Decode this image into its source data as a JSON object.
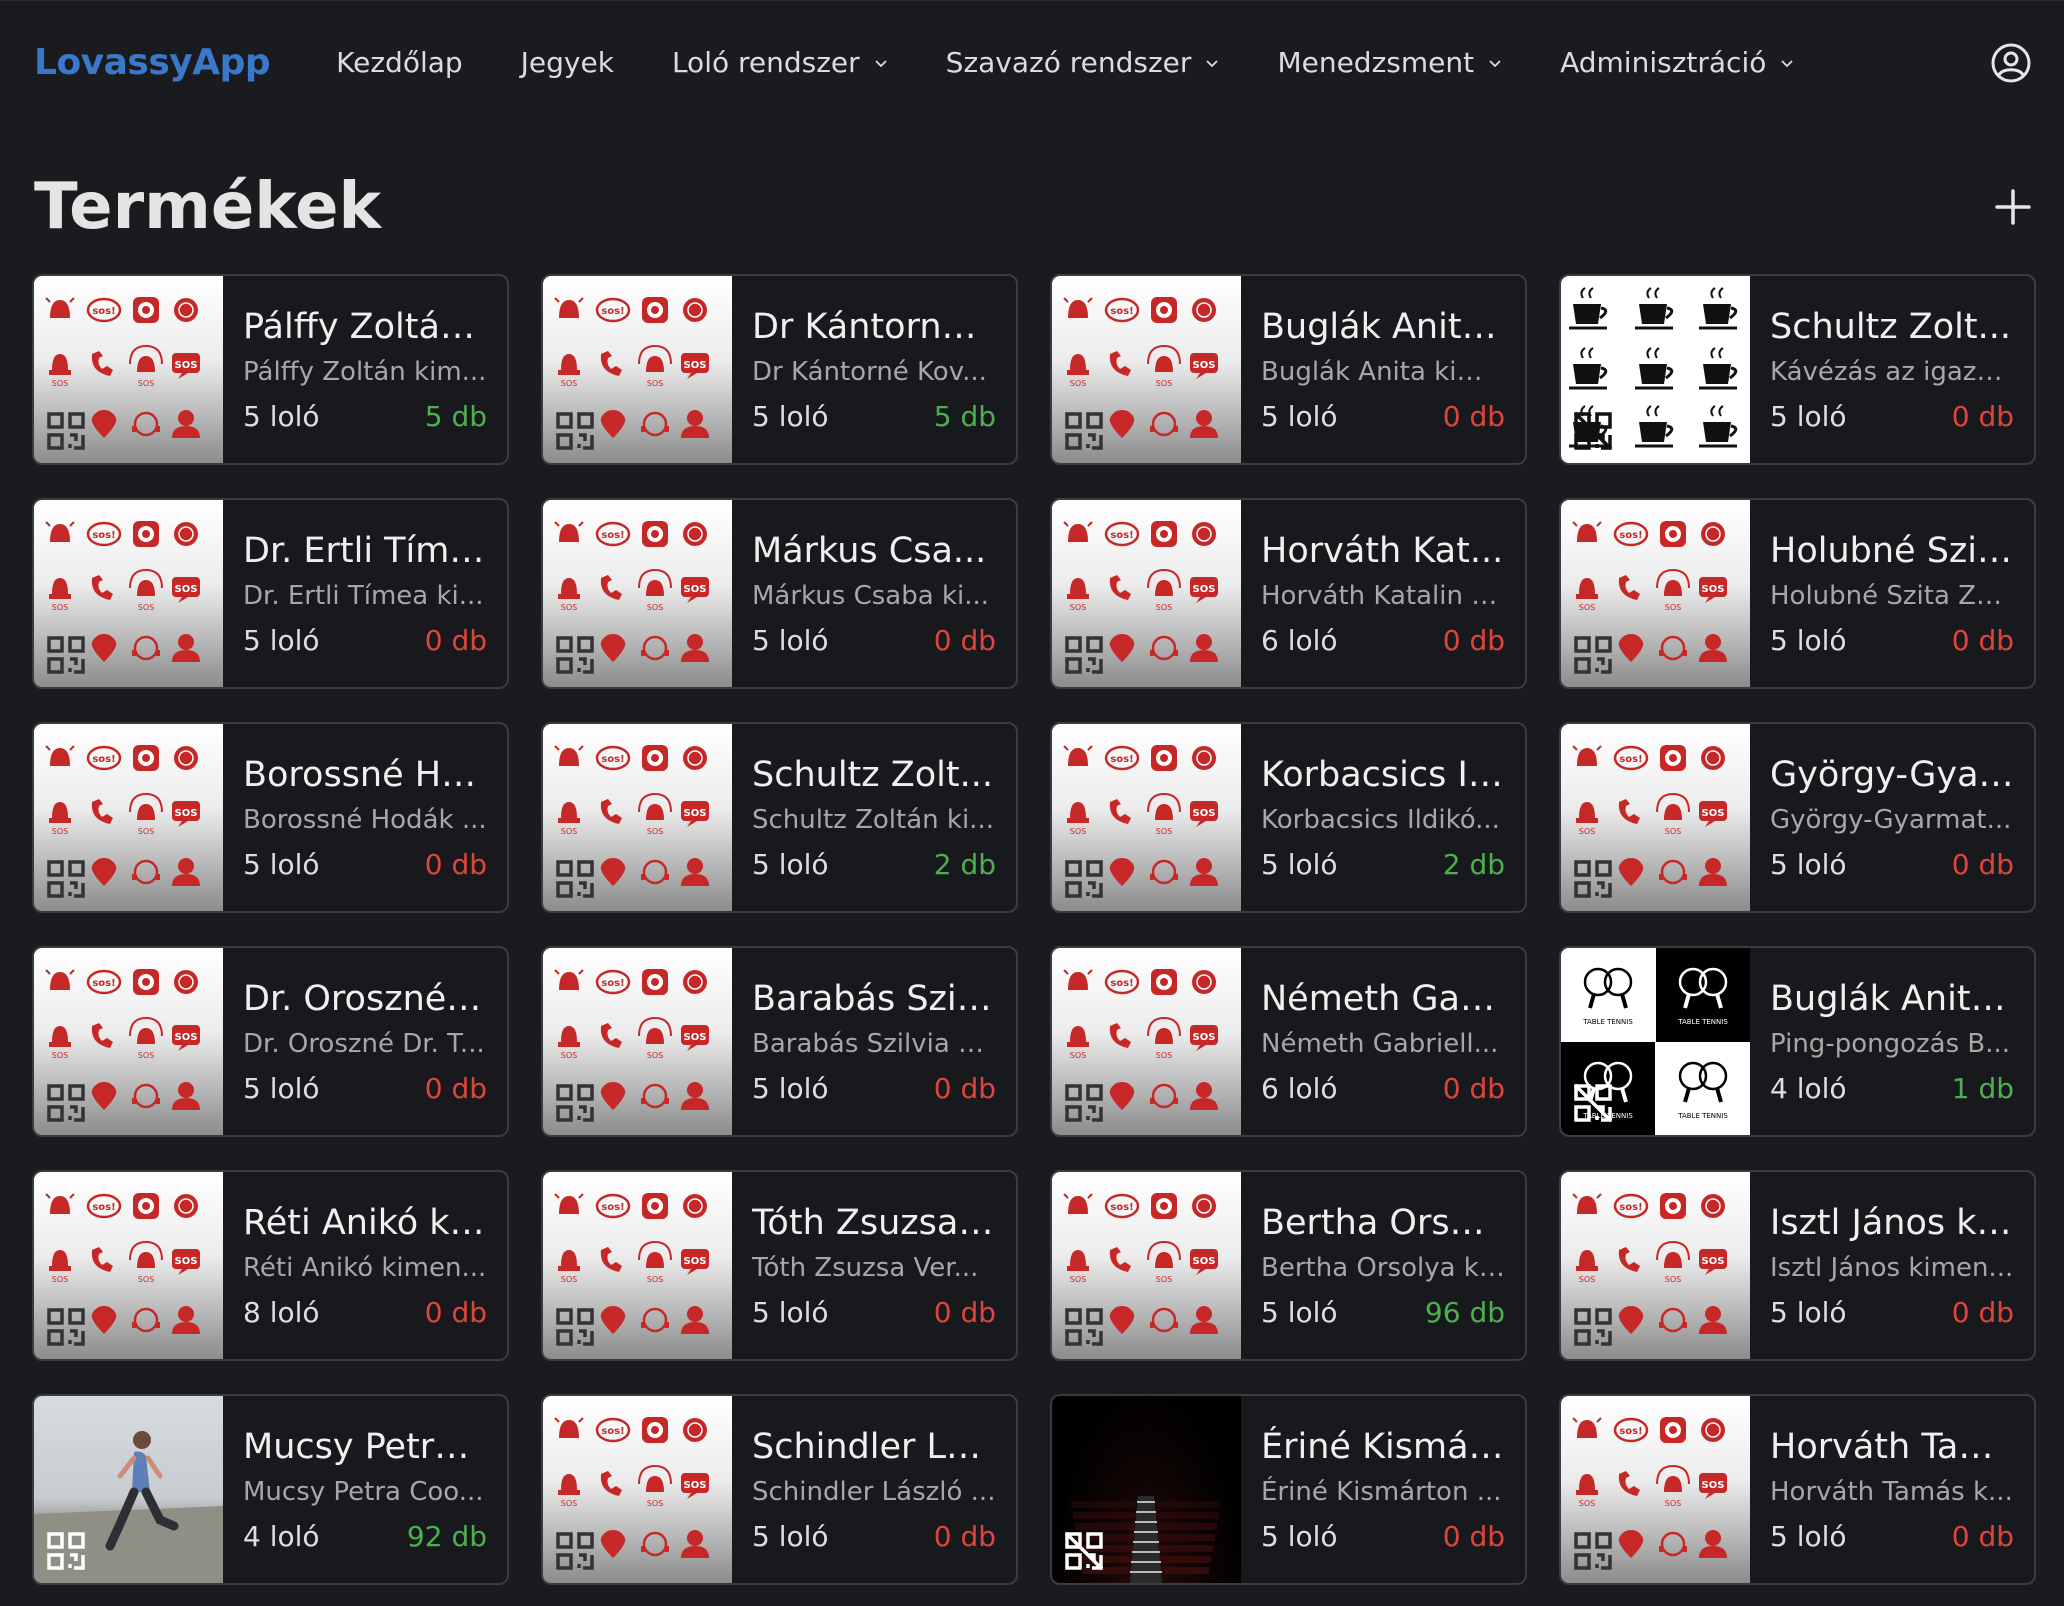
{
  "app": {
    "brand": "LovassyApp"
  },
  "nav": [
    {
      "label": "Kezdőlap",
      "dropdown": false
    },
    {
      "label": "Jegyek",
      "dropdown": false
    },
    {
      "label": "Loló rendszer",
      "dropdown": true
    },
    {
      "label": "Szavazó rendszer",
      "dropdown": true
    },
    {
      "label": "Menedzsment",
      "dropdown": true
    },
    {
      "label": "Adminisztráció",
      "dropdown": true
    }
  ],
  "page": {
    "title": "Termékek"
  },
  "colors": {
    "brand": "#3a78c9",
    "in_stock": "#4caf50",
    "out_of_stock": "#e0433c",
    "sos_red": "#c62828"
  },
  "products": [
    {
      "title": "Pálffy Zoltán...",
      "subtitle": "Pálffy Zoltán kim...",
      "price": "5 loló",
      "stock": "5 db",
      "in_stock": true,
      "image": "sos",
      "qr": true
    },
    {
      "title": "Dr Kántorné ...",
      "subtitle": "Dr Kántorné Kov...",
      "price": "5 loló",
      "stock": "5 db",
      "in_stock": true,
      "image": "sos",
      "qr": true
    },
    {
      "title": "Buglák Anita...",
      "subtitle": "Buglák Anita kim...",
      "price": "5 loló",
      "stock": "0 db",
      "in_stock": false,
      "image": "sos",
      "qr": true
    },
    {
      "title": "Schultz Zolt...",
      "subtitle": "Kávézás az igazg...",
      "price": "5 loló",
      "stock": "0 db",
      "in_stock": false,
      "image": "coffee",
      "qr": false
    },
    {
      "title": "Dr. Ertli Tíme...",
      "subtitle": "Dr. Ertli Tímea ki...",
      "price": "5 loló",
      "stock": "0 db",
      "in_stock": false,
      "image": "sos",
      "qr": true
    },
    {
      "title": "Márkus Csa...",
      "subtitle": "Márkus Csaba ki...",
      "price": "5 loló",
      "stock": "0 db",
      "in_stock": false,
      "image": "sos",
      "qr": true
    },
    {
      "title": "Horváth Kat...",
      "subtitle": "Horváth Katalin k...",
      "price": "6 loló",
      "stock": "0 db",
      "in_stock": false,
      "image": "sos",
      "qr": true
    },
    {
      "title": "Holubné Szit...",
      "subtitle": "Holubné Szita Zs...",
      "price": "5 loló",
      "stock": "0 db",
      "in_stock": false,
      "image": "sos",
      "qr": true
    },
    {
      "title": "Borossné Ho...",
      "subtitle": "Borossné Hodák ...",
      "price": "5 loló",
      "stock": "0 db",
      "in_stock": false,
      "image": "sos",
      "qr": true
    },
    {
      "title": "Schultz Zolt...",
      "subtitle": "Schultz Zoltán ki...",
      "price": "5 loló",
      "stock": "2 db",
      "in_stock": true,
      "image": "sos",
      "qr": true
    },
    {
      "title": "Korbacsics Il...",
      "subtitle": "Korbacsics Ildikó...",
      "price": "5 loló",
      "stock": "2 db",
      "in_stock": true,
      "image": "sos",
      "qr": true
    },
    {
      "title": "György-Gyar...",
      "subtitle": "György-Gyarmat...",
      "price": "5 loló",
      "stock": "0 db",
      "in_stock": false,
      "image": "sos",
      "qr": true
    },
    {
      "title": "Dr. Oroszné ...",
      "subtitle": "Dr. Oroszné Dr. T...",
      "price": "5 loló",
      "stock": "0 db",
      "in_stock": false,
      "image": "sos",
      "qr": true
    },
    {
      "title": "Barabás Szil...",
      "subtitle": "Barabás Szilvia k...",
      "price": "5 loló",
      "stock": "0 db",
      "in_stock": false,
      "image": "sos",
      "qr": true
    },
    {
      "title": "Németh Gab...",
      "subtitle": "Németh Gabriell...",
      "price": "6 loló",
      "stock": "0 db",
      "in_stock": false,
      "image": "sos",
      "qr": true
    },
    {
      "title": "Buglák Anita...",
      "subtitle": "Ping-pongozás B...",
      "price": "4 loló",
      "stock": "1 db",
      "in_stock": true,
      "image": "tennis",
      "qr": false
    },
    {
      "title": "Réti Anikó ki...",
      "subtitle": "Réti Anikó kimen...",
      "price": "8 loló",
      "stock": "0 db",
      "in_stock": false,
      "image": "sos",
      "qr": true
    },
    {
      "title": "Tóth Zsuzsa ...",
      "subtitle": "Tóth Zsuzsa Ver...",
      "price": "5 loló",
      "stock": "0 db",
      "in_stock": false,
      "image": "sos",
      "qr": true
    },
    {
      "title": "Bertha Orsol...",
      "subtitle": "Bertha Orsolya ki...",
      "price": "5 loló",
      "stock": "96 db",
      "in_stock": true,
      "image": "sos",
      "qr": true
    },
    {
      "title": "Isztl János ki...",
      "subtitle": "Isztl János kimen...",
      "price": "5 loló",
      "stock": "0 db",
      "in_stock": false,
      "image": "sos",
      "qr": true
    },
    {
      "title": "Mucsy Petra ...",
      "subtitle": "Mucsy Petra Coo...",
      "price": "4 loló",
      "stock": "92 db",
      "in_stock": true,
      "image": "runner",
      "qr": true
    },
    {
      "title": "Schindler Lá...",
      "subtitle": "Schindler László ...",
      "price": "5 loló",
      "stock": "0 db",
      "in_stock": false,
      "image": "sos",
      "qr": true
    },
    {
      "title": "Ériné Kismár...",
      "subtitle": "Ériné Kismárton ...",
      "price": "5 loló",
      "stock": "0 db",
      "in_stock": false,
      "image": "cinema",
      "qr": false
    },
    {
      "title": "Horváth Tam...",
      "subtitle": "Horváth Tamás k...",
      "price": "5 loló",
      "stock": "0 db",
      "in_stock": false,
      "image": "sos",
      "qr": true
    }
  ]
}
